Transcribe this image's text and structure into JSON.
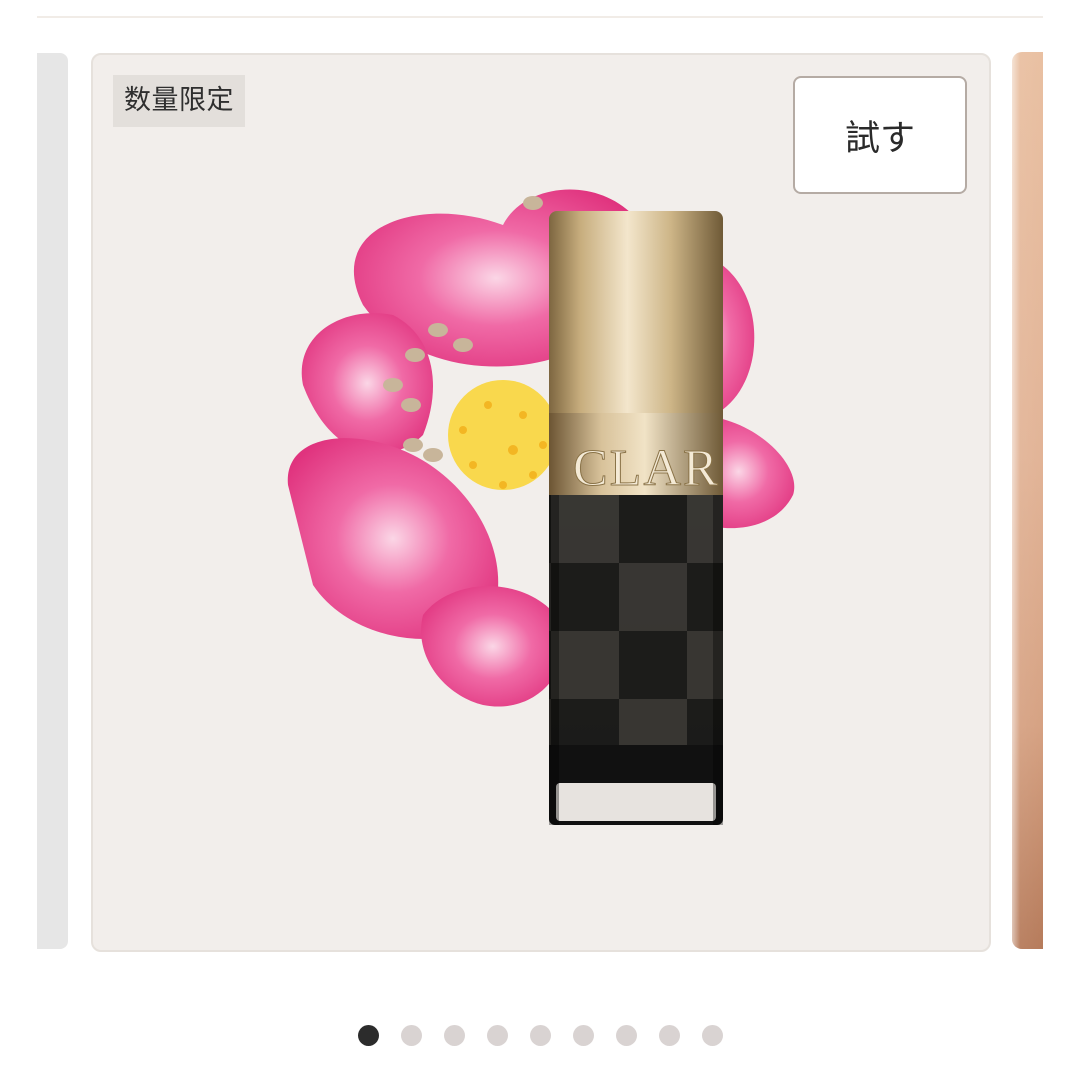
{
  "carousel": {
    "badge": "数量限定",
    "try_label": "試す",
    "bottle_brand_text": "CLAR",
    "slide_count": 9,
    "active_index": 0
  },
  "colors": {
    "card_bg": "#f2eeeb",
    "dot_active": "#2c2c2c",
    "dot_inactive": "#d9d3d2",
    "flower_pink": "#e8378a",
    "gold_cap": "#d6c19a"
  }
}
